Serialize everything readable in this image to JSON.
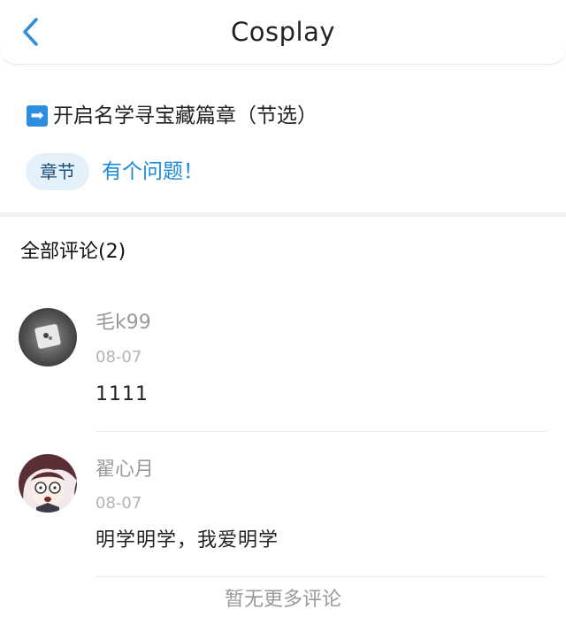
{
  "header": {
    "title": "Cosplay",
    "back_icon": "chevron-left-icon",
    "accent_color": "#2c8ee0"
  },
  "post": {
    "title": "开启名学寻宝藏篇章（节选）",
    "title_icon": "arrow-right-emoji",
    "tag_label": "章节",
    "chapter_link": "有个问题！"
  },
  "comments": {
    "heading": "全部评论(2)",
    "items": [
      {
        "username": "毛k99",
        "date": "08-07",
        "content": "1111"
      },
      {
        "username": "翟心月",
        "date": "08-07",
        "content": "明学明学，我爱明学"
      }
    ],
    "no_more_text": "暂无更多评论"
  }
}
